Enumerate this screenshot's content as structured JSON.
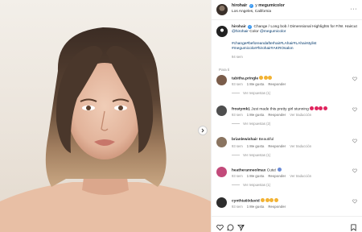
{
  "post": {
    "author": "hirohair",
    "connector": "y",
    "coauthor": "megumicolor",
    "location": "Los Angeles, California",
    "more_label": "···"
  },
  "caption": {
    "author": "hirohair",
    "text": "Change / Long bob / Dimensional Highlights for F/W. Haircut",
    "mention1": "@hirohair",
    "text2": "Color",
    "mention2": "@megumicolor",
    "hashtags": "#change#beforeandafterhair#LAhair#LAhairstylist #megumicolor#hirohair#AKROsalon",
    "time": "94 sem"
  },
  "for_you_label": "Para ti",
  "comments": [
    {
      "user": "tabitha.pringle",
      "text": "",
      "emoji_count": 3,
      "emoji_color": "#f2b233",
      "time": "93 sem",
      "likes": "1 Me gusta",
      "reply": "Responder",
      "translate": "",
      "replies": "Ver respuestas (1)"
    },
    {
      "user": "frostymk1",
      "text": "Just made this pretty girl stunning",
      "emoji_count": 4,
      "emoji_color": "#e0245e",
      "time": "93 sem",
      "likes": "1 Me gusta",
      "reply": "Responder",
      "translate": "Ver traducción",
      "replies": "Ver respuestas (2)"
    },
    {
      "user": "brianlewishair",
      "text": "Beautiful",
      "emoji_count": 0,
      "emoji_color": "",
      "time": "93 sem",
      "likes": "1 Me gusta",
      "reply": "Responder",
      "translate": "Ver traducción",
      "replies": "Ver respuestas (1)"
    },
    {
      "user": "heatheranneolmax",
      "text": "Cute!",
      "emoji_count": 1,
      "emoji_color": "#6a8bd6",
      "time": "93 sem",
      "likes": "1 Me gusta",
      "reply": "Responder",
      "translate": "Ver traducción",
      "replies": "Ver respuestas (1)"
    },
    {
      "user": "cynthia60david",
      "text": "",
      "emoji_count": 4,
      "emoji_color": "#f2b233",
      "time": "93 sem",
      "likes": "1 Me gusta",
      "reply": "Responder",
      "translate": "",
      "replies": ""
    }
  ],
  "actions": [
    "heart-icon",
    "comment-icon",
    "share-icon",
    "bookmark-icon"
  ]
}
